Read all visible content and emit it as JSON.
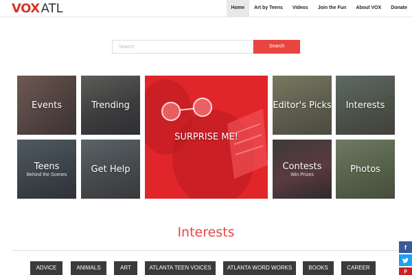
{
  "logo": {
    "vox": "VOX",
    "atl": "ATL"
  },
  "nav": {
    "items": [
      {
        "label": "Home",
        "active": true
      },
      {
        "label": "Art by Teens",
        "active": false
      },
      {
        "label": "Videos",
        "active": false
      },
      {
        "label": "Join the Fun",
        "active": false
      },
      {
        "label": "About VOX",
        "active": false
      },
      {
        "label": "Donate",
        "active": false
      }
    ]
  },
  "search": {
    "placeholder": "Search",
    "value": "",
    "button_label": "Search"
  },
  "tiles": {
    "events": {
      "title": "Events"
    },
    "trending": {
      "title": "Trending"
    },
    "surprise": {
      "title": "SURPRISE ME!"
    },
    "editors_picks": {
      "title": "Editor's Picks"
    },
    "interests": {
      "title": "Interests"
    },
    "teens": {
      "title": "Teens",
      "subtitle": "Behind the Scenes"
    },
    "get_help": {
      "title": "Get Help"
    },
    "contests": {
      "title": "Contests",
      "subtitle": "Win Prizes"
    },
    "photos": {
      "title": "Photos"
    }
  },
  "interests": {
    "heading": "Interests",
    "chips": [
      "ADVICE",
      "ANIMALS",
      "ART",
      "ATLANTA TEEN VOICES",
      "ATLANTA WORD WORKS",
      "BOOKS",
      "CAREER"
    ]
  },
  "social": {
    "facebook_icon": "f",
    "twitter_icon": "✔",
    "pinterest_icon": "p"
  },
  "colors": {
    "accent": "#e94540",
    "brand_red": "#d9342b",
    "surprise_tile": "#e0262a",
    "chip_bg": "#3a3a3a"
  }
}
